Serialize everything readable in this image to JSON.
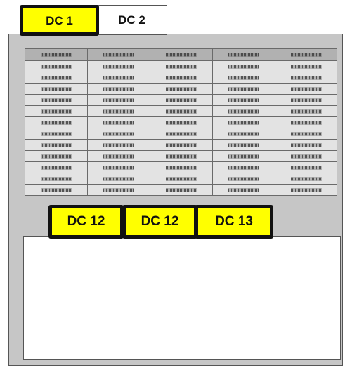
{
  "outer_tabs": [
    {
      "label": "DC 1",
      "active": true
    },
    {
      "label": "DC 2",
      "active": false
    }
  ],
  "table": {
    "columns": 5,
    "header_rows": 1,
    "body_rows": 12,
    "cell_text": "placeholder-hatched"
  },
  "inner_tabs": [
    {
      "label": "DC 12"
    },
    {
      "label": "DC 12"
    },
    {
      "label": "DC 13"
    }
  ],
  "colors": {
    "accent_yellow": "#ffff00",
    "panel_gray": "#c6c6c6",
    "header_gray": "#b1b1b1",
    "cell_gray": "#e3e3e3",
    "border_dark": "#111111"
  }
}
